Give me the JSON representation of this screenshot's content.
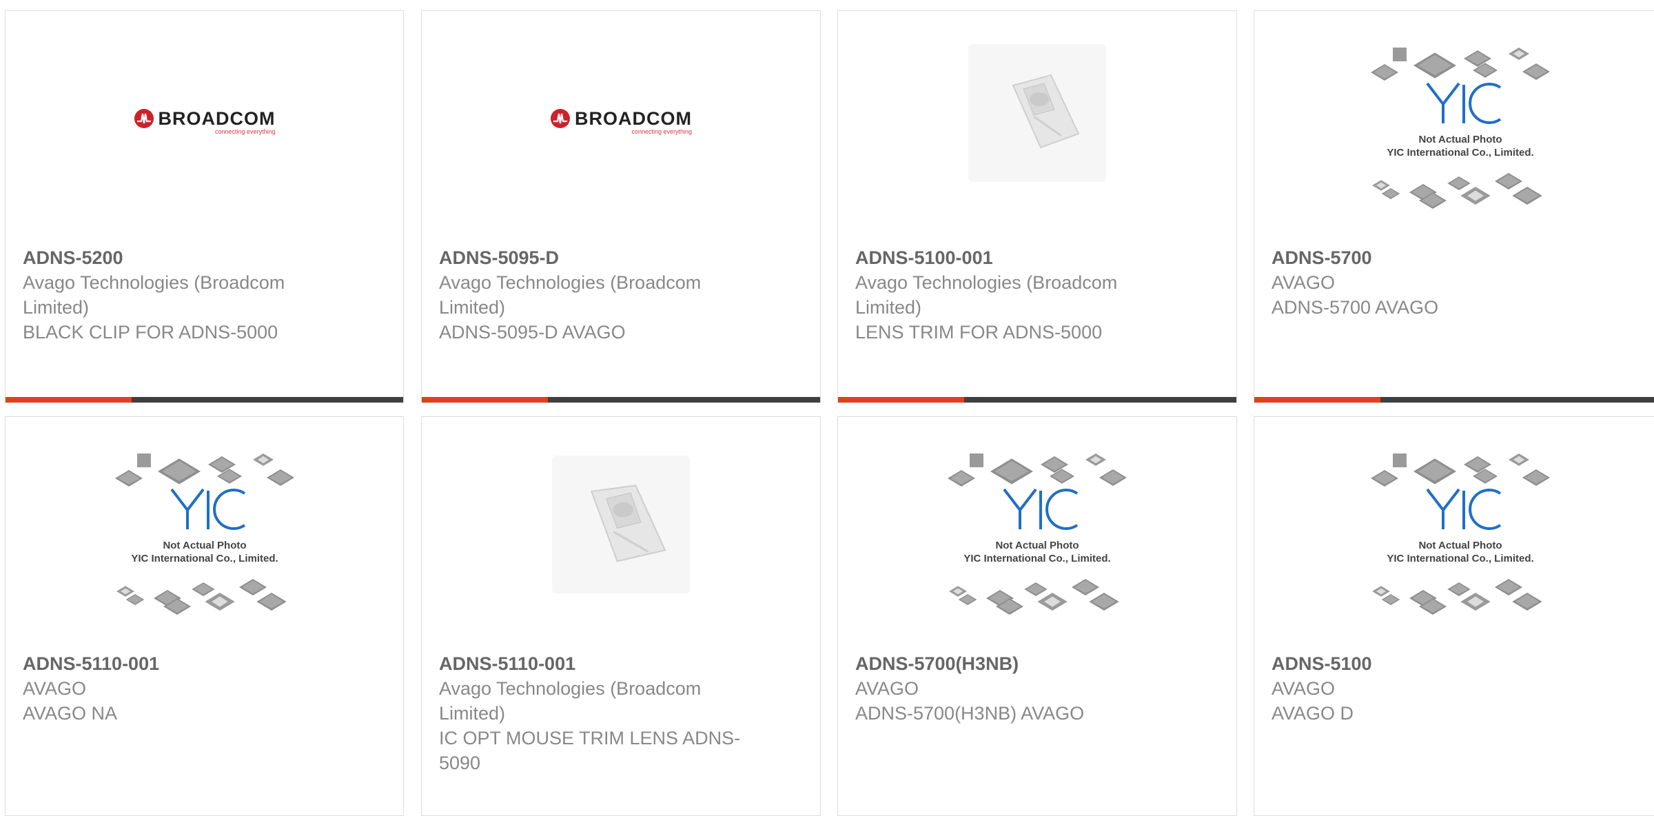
{
  "colors": {
    "accent": "#e2401b",
    "bar": "#3f3f3f",
    "broadcom_red": "#cc2229",
    "yic_blue": "#1f6fc7"
  },
  "placeholder": {
    "line1": "Not Actual Photo",
    "line2": "YIC International Co., Limited.",
    "logo": "YIC"
  },
  "broadcom_logo": {
    "name": "BROADCOM",
    "tagline": "connecting everything"
  },
  "products": [
    {
      "part": "ADNS-5200",
      "maker": "Avago Technologies (Broadcom Limited)",
      "desc": "BLACK CLIP FOR ADNS-5000",
      "image": "broadcom-logo"
    },
    {
      "part": "ADNS-5095-D",
      "maker": "Avago Technologies (Broadcom Limited)",
      "desc": "ADNS-5095-D AVAGO",
      "image": "broadcom-logo"
    },
    {
      "part": "ADNS-5100-001",
      "maker": "Avago Technologies (Broadcom Limited)",
      "desc": "LENS TRIM FOR ADNS-5000",
      "image": "lens-photo"
    },
    {
      "part": "ADNS-5700",
      "maker": "AVAGO",
      "desc": "ADNS-5700 AVAGO",
      "image": "placeholder"
    },
    {
      "part": "ADNS-5110-001",
      "maker": "AVAGO",
      "desc": "AVAGO NA",
      "image": "placeholder"
    },
    {
      "part": "ADNS-5110-001",
      "maker": "Avago Technologies (Broadcom Limited)",
      "desc": "IC OPT MOUSE TRIM LENS ADNS-5090",
      "image": "lens-photo"
    },
    {
      "part": "ADNS-5700(H3NB)",
      "maker": "AVAGO",
      "desc": "ADNS-5700(H3NB) AVAGO",
      "image": "placeholder"
    },
    {
      "part": "ADNS-5100",
      "maker": "AVAGO",
      "desc": "AVAGO D",
      "image": "placeholder"
    }
  ]
}
